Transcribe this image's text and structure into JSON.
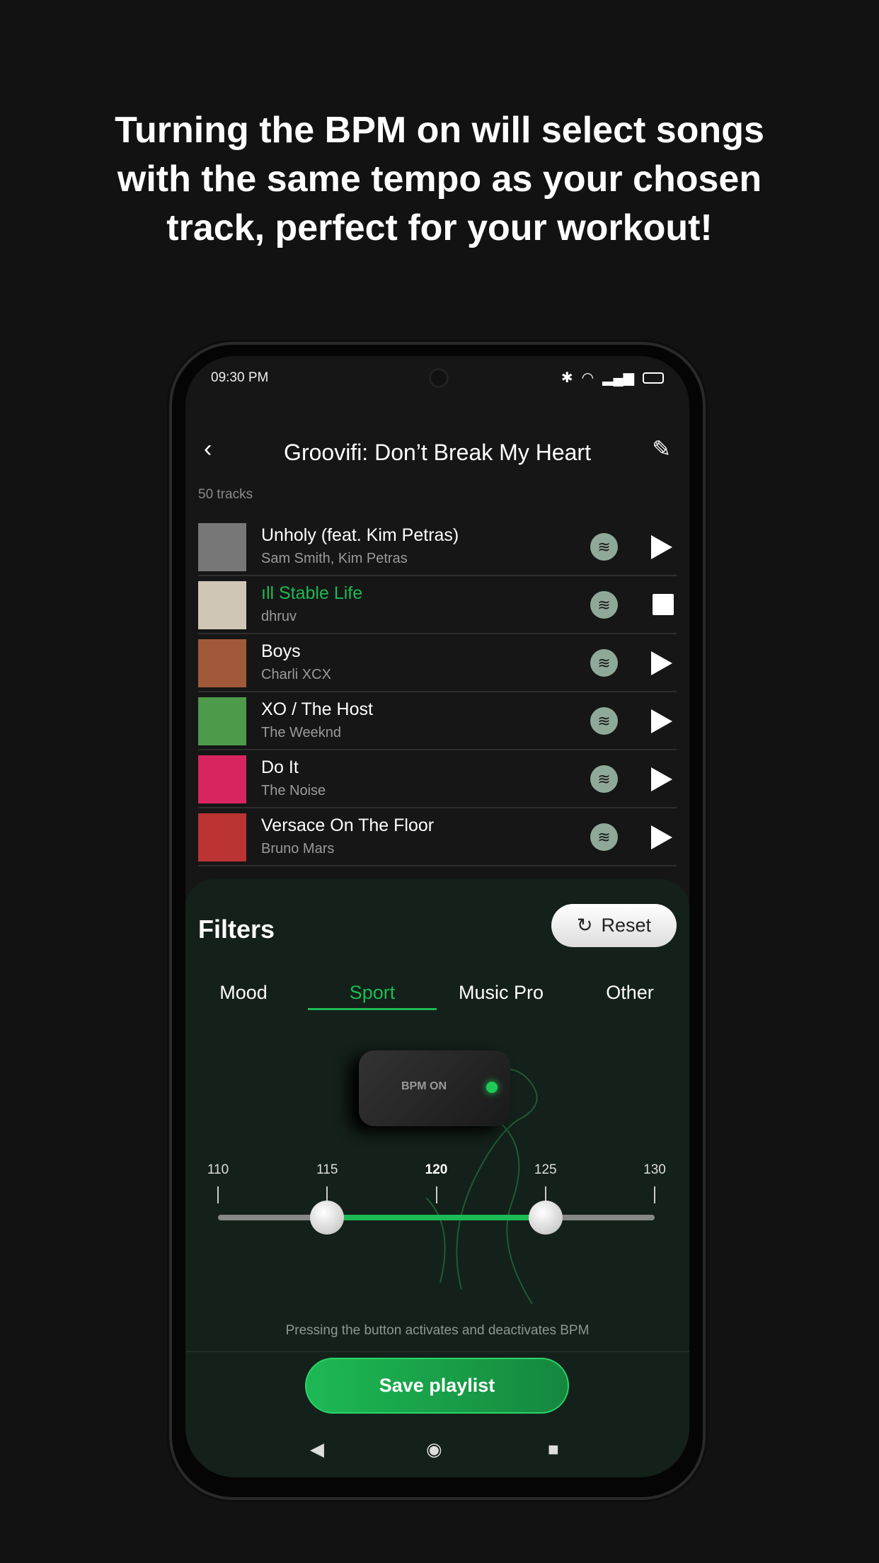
{
  "headline": [
    "Turning the BPM on will select songs",
    "with the same tempo as your chosen",
    "track, perfect for your workout!"
  ],
  "status": {
    "time": "09:30 PM",
    "icons": [
      "bluetooth-icon",
      "wifi-icon",
      "5g-signal-icon",
      "battery-icon"
    ]
  },
  "header": {
    "title": "Groovifi: Don’t Break My Heart",
    "track_count": "50 tracks"
  },
  "tracks": [
    {
      "title": "Unholy (feat. Kim Petras)",
      "artist": "Sam Smith, Kim Petras",
      "playing": false,
      "art": "#777"
    },
    {
      "title": "Stable Life",
      "artist": "dhruv",
      "playing": true,
      "art": "#cfc6b6"
    },
    {
      "title": "Boys",
      "artist": "Charli XCX",
      "playing": false,
      "art": "#a05a3a"
    },
    {
      "title": "XO / The Host",
      "artist": "The Weeknd",
      "playing": false,
      "art": "#4c9a4a"
    },
    {
      "title": "Do It",
      "artist": "The Noise",
      "playing": false,
      "art": "#d8245f"
    },
    {
      "title": "Versace On The Floor",
      "artist": "Bruno Mars",
      "playing": false,
      "art": "#b33"
    }
  ],
  "filters": {
    "title": "Filters",
    "reset": "Reset",
    "tabs": [
      "Mood",
      "Sport",
      "Music Pro",
      "Other"
    ],
    "active_tab": "Sport",
    "device_label": "BPM ON",
    "bpm": {
      "ticks": [
        "110",
        "115",
        "120",
        "125",
        "130"
      ],
      "min": 110,
      "max": 130,
      "low": 115,
      "high": 125
    },
    "help": "Pressing the button activates and deactivates BPM"
  },
  "save": "Save playlist",
  "colors": {
    "accent": "#1db954",
    "panel": "#14201a"
  }
}
